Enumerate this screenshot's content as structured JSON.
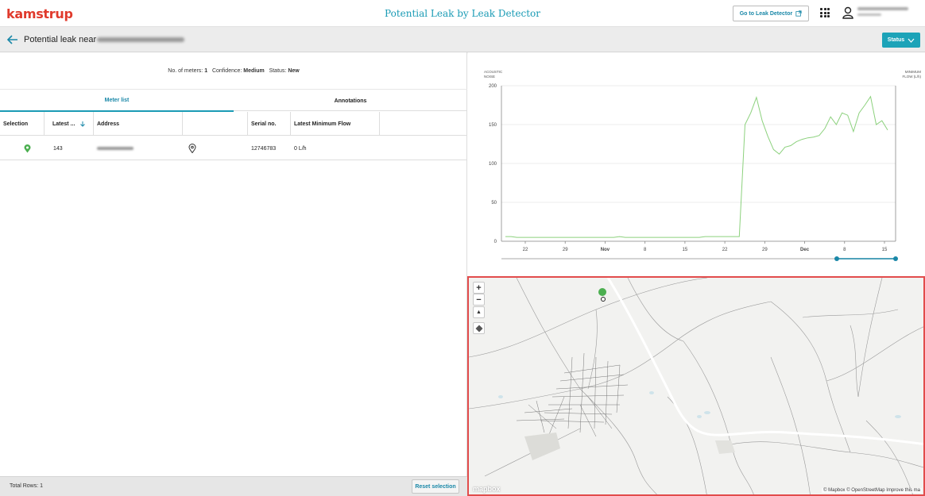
{
  "header": {
    "logo": "kamstrup",
    "app_title": "Potential Leak by Leak Detector",
    "goto_button": "Go to Leak Detector"
  },
  "subheader": {
    "title": "Potential leak near",
    "status_button": "Status"
  },
  "summary": {
    "meters_label": "No. of meters:",
    "meters_value": "1",
    "confidence_label": "Confidence:",
    "confidence_value": "Medium",
    "status_label": "Status:",
    "status_value": "New"
  },
  "tabs": {
    "meter_list": "Meter list",
    "annotations": "Annotations"
  },
  "table": {
    "columns": [
      "Selection",
      "Latest ...",
      "Address",
      "",
      "Serial no.",
      "Latest Minimum Flow"
    ],
    "rows": [
      {
        "latest": "143",
        "serial": "12746783",
        "min_flow": "0 L/h"
      }
    ]
  },
  "footer": {
    "total_rows": "Total Rows: 1",
    "reset_button": "Reset selection"
  },
  "chart_data": {
    "type": "line",
    "left_axis_label": [
      "ACOUSTIC",
      "NOISE"
    ],
    "right_axis_label": [
      "MINIMUM",
      "FLOW (L/h)"
    ],
    "ylim": [
      0,
      200
    ],
    "yticks": [
      "0",
      "50",
      "100",
      "150",
      "200"
    ],
    "xticks": [
      "22",
      "29",
      "Nov",
      "8",
      "15",
      "22",
      "29",
      "Dec",
      "8",
      "15"
    ],
    "bold_ticks": [
      "Nov",
      "Dec"
    ],
    "series": [
      {
        "color": "#8cd17d",
        "values": [
          6,
          6,
          5,
          5,
          5,
          5,
          5,
          5,
          5,
          5,
          5,
          5,
          5,
          5,
          5,
          5,
          5,
          5,
          5,
          5,
          6,
          5,
          5,
          5,
          5,
          5,
          5,
          5,
          5,
          5,
          5,
          5,
          5,
          5,
          5,
          6,
          6,
          6,
          6,
          6,
          6,
          6,
          150,
          165,
          185,
          155,
          135,
          118,
          112,
          121,
          123,
          128,
          131,
          133,
          134,
          136,
          145,
          160,
          150,
          165,
          162,
          141,
          165,
          175,
          186,
          150,
          155,
          143
        ]
      }
    ]
  },
  "map": {
    "zoom_in": "+",
    "zoom_out": "−",
    "compass": "▲",
    "attribution": "© Mapbox © OpenStreetMap Improve this ma",
    "logo": "mapbox"
  }
}
